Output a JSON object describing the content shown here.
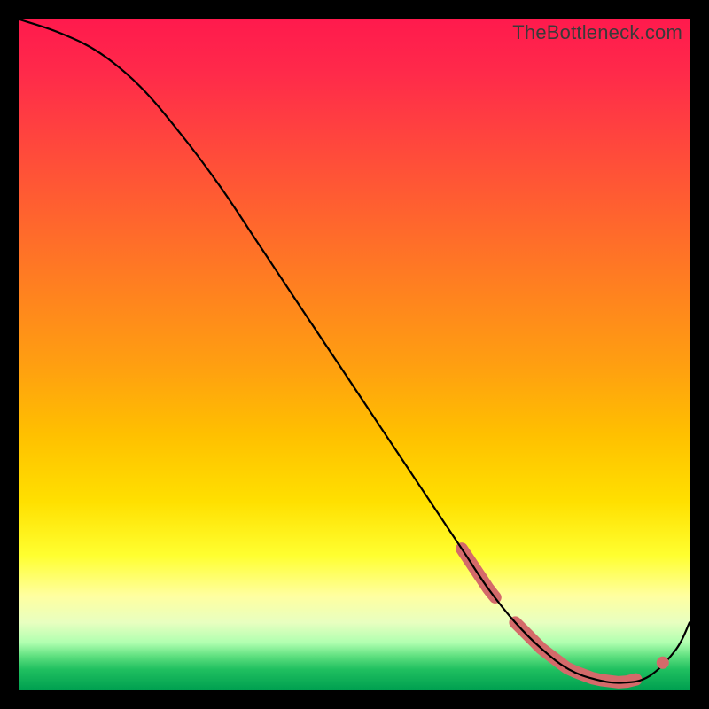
{
  "watermark": "TheBottleneck.com",
  "chart_data": {
    "type": "line",
    "title": "",
    "xlabel": "",
    "ylabel": "",
    "xlim": [
      0,
      100
    ],
    "ylim": [
      0,
      100
    ],
    "series": [
      {
        "name": "curve",
        "x": [
          0,
          6,
          12,
          18,
          24,
          30,
          36,
          42,
          48,
          54,
          60,
          66,
          70,
          74,
          78,
          82,
          86,
          90,
          94,
          98,
          100
        ],
        "y": [
          100,
          98,
          95,
          90,
          83,
          75,
          66,
          57,
          48,
          39,
          30,
          21,
          15,
          10,
          6,
          3,
          1.5,
          1,
          2,
          6,
          10
        ]
      }
    ],
    "highlight_ranges": [
      {
        "x_start": 66,
        "x_end": 71
      },
      {
        "x_start": 74,
        "x_end": 92
      }
    ],
    "highlight_points": [
      {
        "x": 96,
        "y": 4
      }
    ],
    "colors": {
      "curve": "#000000",
      "highlight": "#d46a6a",
      "gradient_top": "#ff1a4d",
      "gradient_mid": "#ffe000",
      "gradient_bottom": "#00a050"
    }
  }
}
